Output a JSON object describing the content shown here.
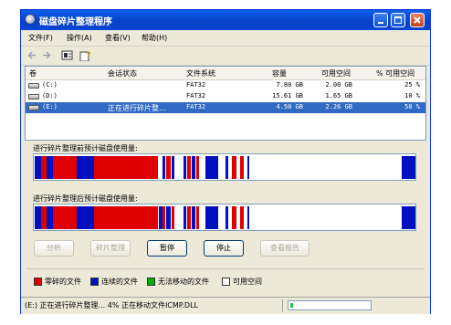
{
  "window": {
    "title": "磁盘碎片整理程序"
  },
  "menu": [
    "文件(F)",
    "操作(A)",
    "查看(V)",
    "帮助(H)"
  ],
  "columns": [
    "卷",
    "会话状态",
    "文件系统",
    "容量",
    "可用空间",
    "% 可用空间"
  ],
  "volumes": [
    {
      "name": "(C:)",
      "status": "",
      "fs": "FAT32",
      "capacity": "7.80 GB",
      "free": "2.00 GB",
      "pct": "25 %"
    },
    {
      "name": "(D:)",
      "status": "",
      "fs": "FAT32",
      "capacity": "15.61 GB",
      "free": "1.65 GB",
      "pct": "10 %"
    },
    {
      "name": "(E:)",
      "status": "正在进行碎片整...",
      "fs": "FAT32",
      "capacity": "4.50 GB",
      "free": "2.26 GB",
      "pct": "50 %"
    }
  ],
  "analysis": {
    "before_label": "进行碎片整理前预计磁盘使用量:",
    "after_label": "进行碎片整理后预计磁盘使用量:"
  },
  "buttons": {
    "analyze": "分析",
    "defrag": "碎片整理",
    "pause": "暂停",
    "stop": "停止",
    "report": "查看报告"
  },
  "legend": [
    {
      "label": "零碎的文件",
      "color": "#e00000"
    },
    {
      "label": "连续的文件",
      "color": "#0010c0"
    },
    {
      "label": "无法移动的文件",
      "color": "#00b000"
    },
    {
      "label": "可用空间",
      "color": "#ffffff"
    }
  ],
  "status": {
    "text": "(E:) 正在进行碎片整理... 4%  正在移动文件ICMP.DLL",
    "progress": 0.04
  },
  "colors": {
    "fragmented": "#e00000",
    "contiguous": "#0010c0",
    "unmovable": "#00b000",
    "free": "#ffffff"
  }
}
